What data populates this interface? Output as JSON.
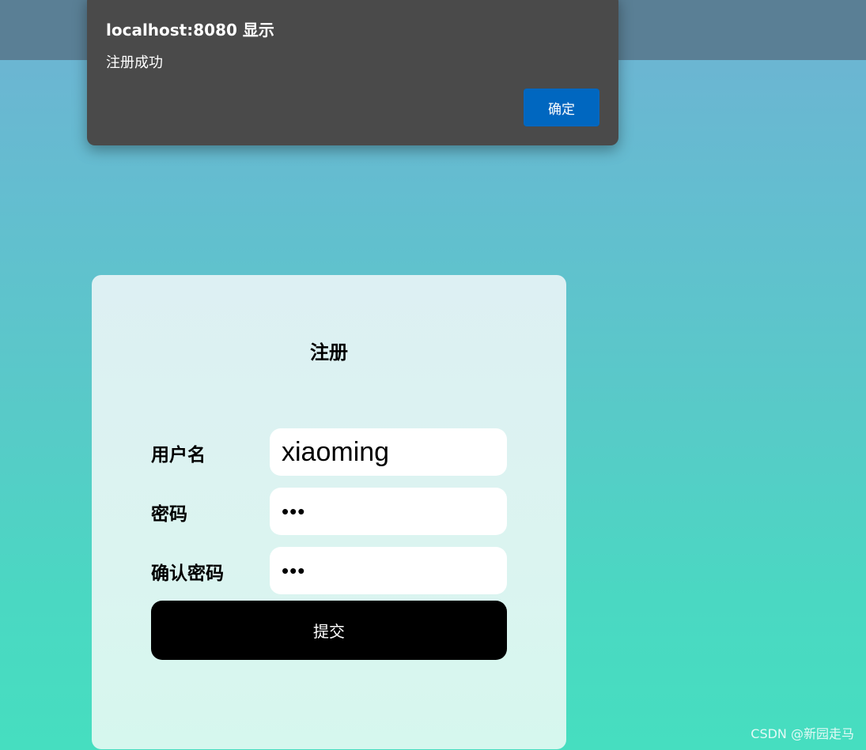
{
  "dialog": {
    "title": "localhost:8080 显示",
    "message": "注册成功",
    "ok_label": "确定",
    "ok_color": "#0067c0"
  },
  "register": {
    "title": "注册",
    "username_label": "用户名",
    "username_value": "xiaoming",
    "password_label": "密码",
    "password_value": "•••",
    "confirm_label": "确认密码",
    "confirm_value": "•••",
    "submit_label": "提交"
  },
  "watermark": "CSDN @新园走马"
}
